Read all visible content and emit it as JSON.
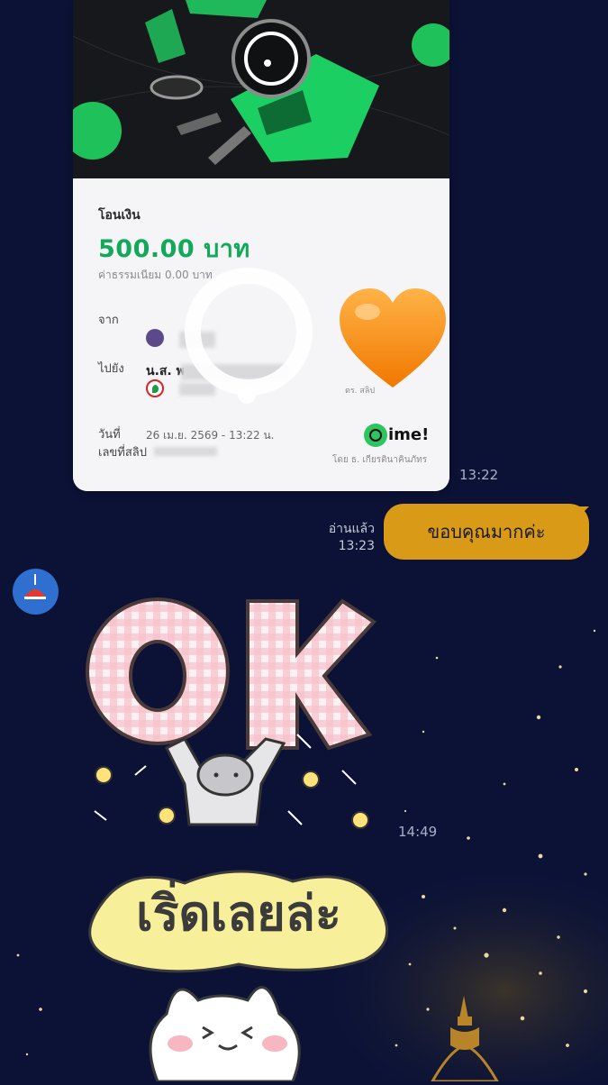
{
  "slip": {
    "title": "โอนเงิน",
    "amount": "500.00 บาท",
    "fee": "ค่าธรรมเนียม 0.00 บาท",
    "from_label": "จาก",
    "to_label": "ไปยัง",
    "to_name": "น.ส. พ",
    "date_label": "วันที่",
    "date_value": "26 เม.ย. 2569 - 13:22 น.",
    "ref_label": "เลขที่สลิป",
    "brand": "ime!",
    "bank_footer": "โดย ธ. เกียรตินาคินภัทร",
    "scan_hint": "ตร. สลิป",
    "colors": {
      "amount": "#14a85a",
      "banner_bg": "#17181b"
    }
  },
  "messages": {
    "slip_time": "13:22",
    "read_label": "อ่านแล้ว",
    "read_time": "13:23",
    "reply_text": "ขอบคุณมากค่ะ",
    "reply_color": "#d99a17",
    "sticker_time": "14:49",
    "sticker1_text": "OK",
    "sticker2_text": "เริ่ดเลยล่ะ"
  },
  "icons": [
    "heart-emoji-icon",
    "dime-logo-icon",
    "bank-kk-icon",
    "bank-kbank-icon",
    "lamp-avatar-icon"
  ]
}
